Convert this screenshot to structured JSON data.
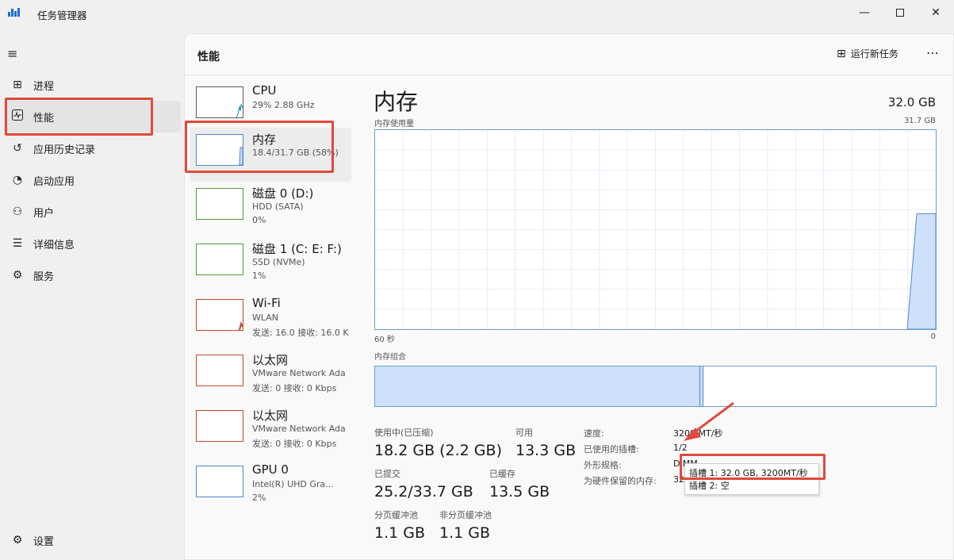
{
  "window": {
    "title": "任务管理器",
    "minimize_icon": "minimize-icon",
    "maximize_icon": "maximize-icon",
    "close_icon": "close-icon"
  },
  "nav": {
    "items": [
      {
        "label": "进程",
        "icon": "processes-icon"
      },
      {
        "label": "性能",
        "icon": "performance-icon",
        "active": true
      },
      {
        "label": "应用历史记录",
        "icon": "history-icon"
      },
      {
        "label": "启动应用",
        "icon": "startup-icon"
      },
      {
        "label": "用户",
        "icon": "users-icon"
      },
      {
        "label": "详细信息",
        "icon": "details-icon"
      },
      {
        "label": "服务",
        "icon": "services-icon"
      }
    ],
    "settings_label": "设置"
  },
  "header": {
    "title": "性能",
    "run_task_label": "运行新任务",
    "more_label": "⋯"
  },
  "resources": [
    {
      "name": "CPU",
      "sub1": "29% 2.88 GHz",
      "sub2": "",
      "color": "#1a8fa0"
    },
    {
      "name": "内存",
      "sub1": "18.4/31.7 GB (58%)",
      "sub2": "",
      "color": "#4f86d0",
      "active": true
    },
    {
      "name": "磁盘 0 (D:)",
      "sub1": "HDD (SATA)",
      "sub2": "0%",
      "color": "#4f9a3a"
    },
    {
      "name": "磁盘 1 (C: E: F:)",
      "sub1": "SSD (NVMe)",
      "sub2": "1%",
      "color": "#4f9a3a"
    },
    {
      "name": "Wi-Fi",
      "sub1": "WLAN",
      "sub2": "发送: 16.0  接收: 16.0 K",
      "color": "#c04a2c"
    },
    {
      "name": "以太网",
      "sub1": "VMware Network Ada",
      "sub2": "发送: 0  接收: 0 Kbps",
      "color": "#c04a2c"
    },
    {
      "name": "以太网",
      "sub1": "VMware Network Ada",
      "sub2": "发送: 0  接收: 0 Kbps",
      "color": "#c04a2c"
    },
    {
      "name": "GPU 0",
      "sub1": "Intel(R) UHD Gra...",
      "sub2": "2%",
      "color": "#4f86d0"
    }
  ],
  "memory": {
    "title": "内存",
    "total": "32.0 GB",
    "usage_label": "内存使用量",
    "usage_max": "31.7 GB",
    "axis_left": "60 秒",
    "axis_right": "0",
    "composition_label": "内存组合",
    "usage_history_fraction": [
      0,
      0,
      0,
      0,
      0,
      0,
      0,
      0,
      0,
      0,
      0,
      0,
      0,
      0,
      0,
      0,
      0,
      0,
      0,
      0,
      0,
      0,
      0,
      0,
      0,
      0,
      0,
      0,
      0,
      0,
      0,
      0,
      0,
      0,
      0,
      0,
      0,
      0,
      0,
      0,
      0,
      0,
      0,
      0,
      0,
      0,
      0,
      0,
      0,
      0,
      0,
      0,
      0,
      0,
      0,
      0,
      0,
      0.58,
      0.58,
      0.58
    ],
    "composition": {
      "in_use_fraction": 0.58,
      "modified_fraction": 0.006
    },
    "stats": {
      "in_use_label": "使用中(已压缩)",
      "in_use_value": "18.2 GB (2.2 GB)",
      "available_label": "可用",
      "available_value": "13.3 GB",
      "committed_label": "已提交",
      "committed_value": "25.2/33.7 GB",
      "cached_label": "已缓存",
      "cached_value": "13.5 GB",
      "paged_label": "分页缓冲池",
      "paged_value": "1.1 GB",
      "nonpaged_label": "非分页缓冲池",
      "nonpaged_value": "1.1 GB"
    },
    "props": [
      {
        "key": "速度:",
        "value": "3200 MT/秒"
      },
      {
        "key": "已使用的插槽:",
        "value": "1/2"
      },
      {
        "key": "外形规格:",
        "value": "DIMM"
      },
      {
        "key": "为硬件保留的内存:",
        "value": "32"
      }
    ],
    "tooltip": {
      "line1": "插槽 1: 32.0 GB, 3200MT/秒",
      "line2": "插槽 2: 空"
    }
  },
  "annotation_color": "#e04a3c"
}
